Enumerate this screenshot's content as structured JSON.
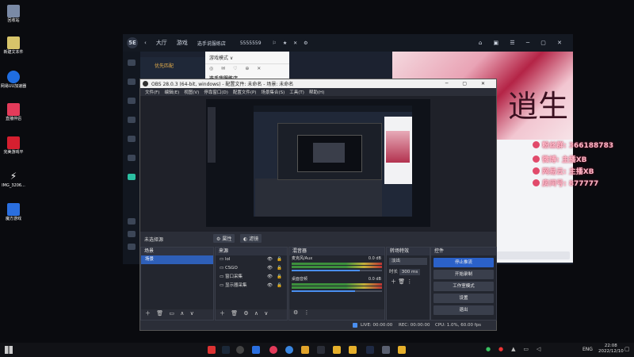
{
  "desktop_icons": [
    {
      "label": "回收站",
      "color": "#7a8aa6"
    },
    {
      "label": "新建文本件",
      "color": "#d7c46a"
    },
    {
      "label": "网易UU加速器",
      "color": "#1f6de0"
    },
    {
      "label": "直播伴侣",
      "color": "#e33b5a"
    },
    {
      "label": "完美游戏平",
      "color": "#d51f2f"
    },
    {
      "label": "IMG_3206...",
      "color": "#e6e6e6"
    },
    {
      "label": "魔方游戏",
      "color": "#2a6fe0"
    }
  ],
  "client": {
    "logo": "5E",
    "nav": [
      "大厅",
      "游戏",
      "选手说服练店"
    ],
    "room_id": "5555559",
    "left_tab": "优先匹配",
    "popup_title": "游戏模式 ∨",
    "popup_item": "选手我服练店"
  },
  "obs": {
    "title": "OBS 28.0.3 (64-bit, windows) - 配置文件: 未命名 - 场景: 未命名",
    "menu": [
      "文件(F)",
      "编辑(E)",
      "视图(V)",
      "停靠窗口(D)",
      "配置文件(P)",
      "场景集合(S)",
      "工具(T)",
      "帮助(H)"
    ],
    "no_source": "未选择源",
    "props_btn": "属性",
    "filter_btn": "滤镜",
    "docks": {
      "scenes": {
        "title": "场景",
        "items": [
          "场景"
        ]
      },
      "sources": {
        "title": "来源",
        "items": [
          "lol",
          "CSGO",
          "窗口采集",
          "显示器采集"
        ]
      },
      "mixer": {
        "title": "混音器",
        "channels": [
          {
            "name": "麦克风/Aux",
            "db": "0.0 dB",
            "level": 0.75
          },
          {
            "name": "桌面音频",
            "db": "0.0 dB",
            "level": 0.7
          }
        ]
      },
      "transitions": {
        "title": "转场特效",
        "type": "淡出",
        "duration_label": "时长",
        "duration": "300 ms"
      },
      "controls": {
        "title": "控件",
        "buttons": [
          "停止推流",
          "开始录制",
          "工作室模式",
          "设置",
          "退出"
        ]
      }
    },
    "status": {
      "live": "LIVE: 00:00:00",
      "rec": "REC: 00:00:00",
      "cpu": "CPU: 1.0%, 60.00 fps"
    }
  },
  "overlay": [
    "粉丝群: 366188783",
    "微博: 主播XB",
    "网易云: 主播XB",
    "房间号: 877777"
  ],
  "taskbar": {
    "lang": "ENG",
    "time": "22:08",
    "date": "2022/12/10"
  }
}
